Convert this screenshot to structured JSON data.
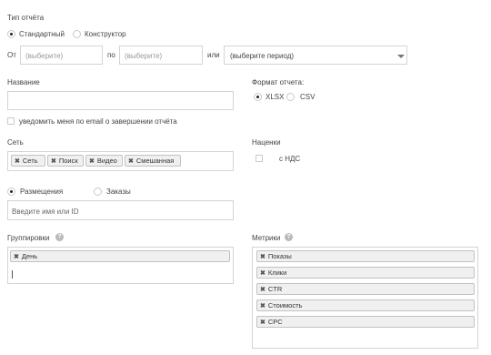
{
  "report_type": {
    "label": "Тип отчёта",
    "options": [
      "Стандартный",
      "Конструктор"
    ],
    "selected": "Стандартный"
  },
  "period": {
    "from_label": "От",
    "from_placeholder": "(выберите)",
    "to_label": "по",
    "to_placeholder": "(выберите)",
    "or_label": "или",
    "preset_value": "(выберите период)"
  },
  "name": {
    "label": "Название",
    "value": ""
  },
  "notify": {
    "label": "уведомить меня по email о завершении отчёта",
    "checked": false
  },
  "report_format": {
    "label": "Формат отчета:",
    "options": [
      "XLSX",
      "CSV"
    ],
    "selected": "XLSX"
  },
  "network": {
    "label": "Сеть",
    "tags": [
      "Сеть",
      "Поиск",
      "Видео",
      "Смешанная"
    ]
  },
  "markups": {
    "label": "Наценки",
    "vat_label": "с НДС",
    "vat_checked": false
  },
  "scope": {
    "options": [
      "Размещения",
      "Заказы"
    ],
    "selected": "Размещения",
    "input_placeholder": "Введите имя или ID"
  },
  "groupings": {
    "label": "Группировки",
    "help_glyph": "?",
    "tags": [
      "День"
    ]
  },
  "metrics": {
    "label": "Метрики",
    "help_glyph": "?",
    "tags": [
      "Показы",
      "Клики",
      "CTR",
      "Стоимость",
      "CPC"
    ]
  },
  "icons": {
    "remove_tag": "remove-x-icon",
    "dropdown": "chevron-down-icon",
    "help": "question-circle-icon"
  },
  "colors": {
    "border": "#d4d4d4",
    "tag_bg": "#f0f0f0",
    "help_bg": "#b8b8b8"
  }
}
